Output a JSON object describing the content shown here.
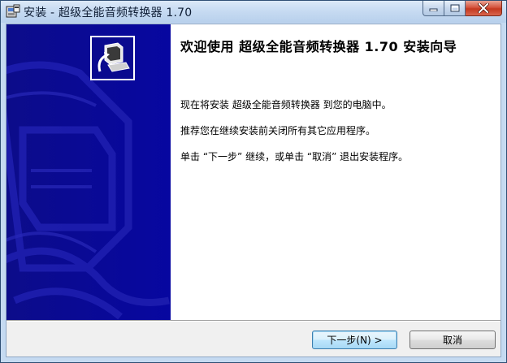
{
  "window": {
    "title": "安装 - 超级全能音频转换器 1.70",
    "icons": {
      "app": "installer-app-icon",
      "minimize": "minimize-icon",
      "maximize": "maximize-icon",
      "close": "close-icon"
    }
  },
  "sidebar": {
    "background_color": "#0a0a8f",
    "logo_icon": "setup-computer-icon"
  },
  "content": {
    "heading": "欢迎使用 超级全能音频转换器 1.70 安装向导",
    "paragraphs": [
      "现在将安装 超级全能音频转换器 到您的电脑中。",
      "推荐您在继续安装前关闭所有其它应用程序。",
      "单击 “下一步” 继续，或单击 “取消” 退出安装程序。"
    ]
  },
  "buttons": {
    "next_label": "下一步(N) >",
    "cancel_label": "取消"
  }
}
